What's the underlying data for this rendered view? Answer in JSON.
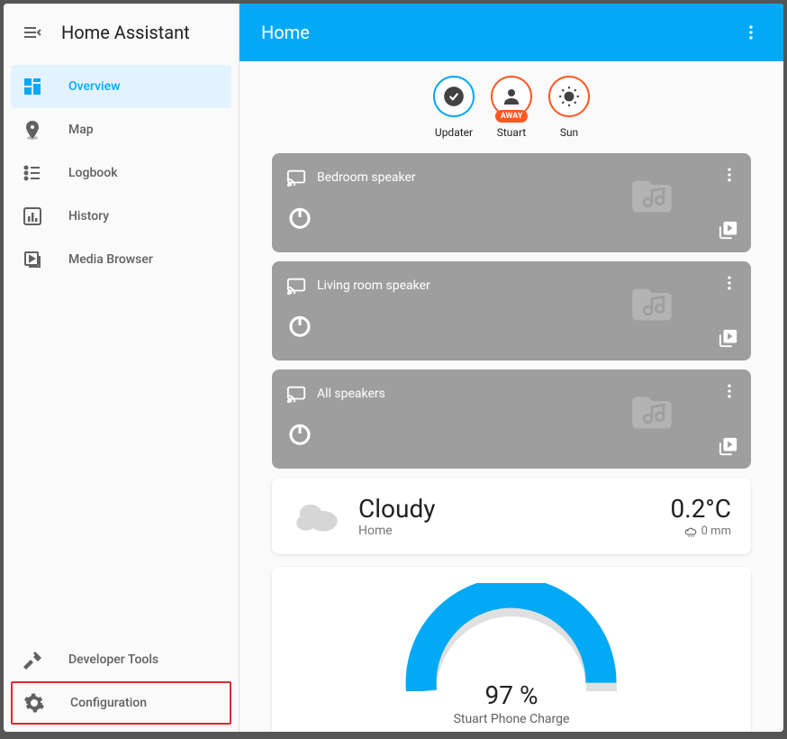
{
  "app": {
    "title": "Home Assistant"
  },
  "sidebar": {
    "items": [
      {
        "label": "Overview"
      },
      {
        "label": "Map"
      },
      {
        "label": "Logbook"
      },
      {
        "label": "History"
      },
      {
        "label": "Media Browser"
      }
    ],
    "footer": [
      {
        "label": "Developer Tools"
      },
      {
        "label": "Configuration"
      }
    ]
  },
  "topbar": {
    "title": "Home"
  },
  "badges": [
    {
      "label": "Updater",
      "color": "blue"
    },
    {
      "label": "Stuart",
      "color": "orange",
      "pill": "AWAY"
    },
    {
      "label": "Sun",
      "color": "orange"
    }
  ],
  "media_cards": [
    {
      "title": "Bedroom speaker"
    },
    {
      "title": "Living room speaker"
    },
    {
      "title": "All speakers"
    }
  ],
  "weather": {
    "condition": "Cloudy",
    "location": "Home",
    "temp": "0.2°C",
    "precip": "0 mm"
  },
  "gauge": {
    "value": "97 %",
    "label": "Stuart Phone Charge",
    "percent": 97
  },
  "colors": {
    "primary": "#03a9f4",
    "accent": "#ff5722"
  }
}
